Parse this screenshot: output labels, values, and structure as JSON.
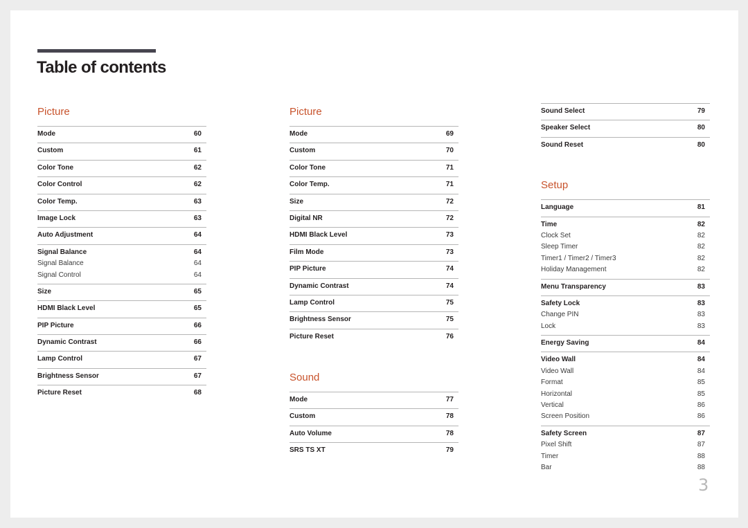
{
  "page": {
    "title": "Table of contents",
    "page_number": "3",
    "accent_color": "#c8532c",
    "bar_color": "#47454f"
  },
  "columns": [
    {
      "sections": [
        {
          "heading": "Picture",
          "entries": [
            {
              "label": "Mode",
              "page": "60"
            },
            {
              "label": "Custom",
              "page": "61"
            },
            {
              "label": "Color Tone",
              "page": "62"
            },
            {
              "label": "Color Control",
              "page": "62"
            },
            {
              "label": "Color Temp.",
              "page": "63"
            },
            {
              "label": "Image Lock",
              "page": "63"
            },
            {
              "label": "Auto Adjustment",
              "page": "64"
            },
            {
              "label": "Signal Balance",
              "page": "64",
              "subs": [
                {
                  "label": "Signal Balance",
                  "page": "64"
                },
                {
                  "label": "Signal Control",
                  "page": "64"
                }
              ]
            },
            {
              "label": "Size",
              "page": "65"
            },
            {
              "label": "HDMI Black Level",
              "page": "65"
            },
            {
              "label": "PIP Picture",
              "page": "66"
            },
            {
              "label": "Dynamic Contrast",
              "page": "66"
            },
            {
              "label": "Lamp Control",
              "page": "67"
            },
            {
              "label": "Brightness Sensor",
              "page": "67"
            },
            {
              "label": "Picture Reset",
              "page": "68"
            }
          ]
        }
      ]
    },
    {
      "sections": [
        {
          "heading": "Picture",
          "entries": [
            {
              "label": "Mode",
              "page": "69"
            },
            {
              "label": "Custom",
              "page": "70"
            },
            {
              "label": "Color Tone",
              "page": "71"
            },
            {
              "label": "Color Temp.",
              "page": "71"
            },
            {
              "label": "Size",
              "page": "72"
            },
            {
              "label": "Digital NR",
              "page": "72"
            },
            {
              "label": "HDMI Black Level",
              "page": "73"
            },
            {
              "label": "Film Mode",
              "page": "73"
            },
            {
              "label": "PIP Picture",
              "page": "74"
            },
            {
              "label": "Dynamic Contrast",
              "page": "74"
            },
            {
              "label": "Lamp Control",
              "page": "75"
            },
            {
              "label": "Brightness Sensor",
              "page": "75"
            },
            {
              "label": "Picture Reset",
              "page": "76"
            }
          ]
        },
        {
          "heading": "Sound",
          "entries": [
            {
              "label": "Mode",
              "page": "77"
            },
            {
              "label": "Custom",
              "page": "78"
            },
            {
              "label": "Auto Volume",
              "page": "78"
            },
            {
              "label": "SRS TS XT",
              "page": "79"
            }
          ]
        }
      ]
    },
    {
      "sections": [
        {
          "heading": "",
          "entries": [
            {
              "label": "Sound Select",
              "page": "79"
            },
            {
              "label": "Speaker Select",
              "page": "80"
            },
            {
              "label": "Sound Reset",
              "page": "80"
            }
          ]
        },
        {
          "heading": "Setup",
          "entries": [
            {
              "label": "Language",
              "page": "81"
            },
            {
              "label": "Time",
              "page": "82",
              "subs": [
                {
                  "label": "Clock Set",
                  "page": "82"
                },
                {
                  "label": "Sleep Timer",
                  "page": "82"
                },
                {
                  "label": "Timer1 / Timer2 / Timer3",
                  "page": "82"
                },
                {
                  "label": "Holiday Management",
                  "page": "82"
                }
              ]
            },
            {
              "label": "Menu Transparency",
              "page": "83"
            },
            {
              "label": "Safety Lock",
              "page": "83",
              "subs": [
                {
                  "label": "Change PIN",
                  "page": "83"
                },
                {
                  "label": "Lock",
                  "page": "83"
                }
              ]
            },
            {
              "label": "Energy Saving",
              "page": "84"
            },
            {
              "label": "Video Wall",
              "page": "84",
              "subs": [
                {
                  "label": "Video Wall",
                  "page": "84"
                },
                {
                  "label": "Format",
                  "page": "85"
                },
                {
                  "label": "Horizontal",
                  "page": "85"
                },
                {
                  "label": "Vertical",
                  "page": "86"
                },
                {
                  "label": "Screen Position",
                  "page": "86"
                }
              ]
            },
            {
              "label": "Safety Screen",
              "page": "87",
              "subs": [
                {
                  "label": "Pixel Shift",
                  "page": "87"
                },
                {
                  "label": "Timer",
                  "page": "88"
                },
                {
                  "label": "Bar",
                  "page": "88"
                }
              ]
            }
          ]
        }
      ]
    }
  ]
}
